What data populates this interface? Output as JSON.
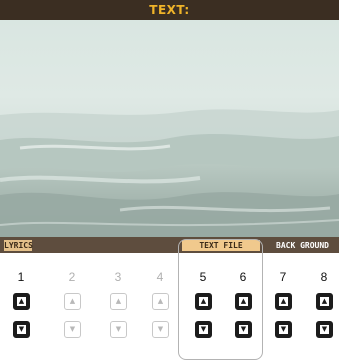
{
  "screen": {
    "title": "TEXT:"
  },
  "tabs": {
    "lyrics": "LYRICS",
    "text_file": "TEXT FILE",
    "background": "BACK GROUND"
  },
  "controls": {
    "numbers": [
      "1",
      "2",
      "3",
      "4",
      "5",
      "6",
      "7",
      "8"
    ],
    "enabled": [
      true,
      false,
      false,
      false,
      true,
      true,
      true,
      true
    ]
  },
  "colors": {
    "title_text": "#f0b429",
    "title_bar": "#3b2e22",
    "tab_strip": "#5e4d3e",
    "tab_active": "#f0c98d"
  },
  "icons": {
    "up": "up-arrow-icon",
    "down": "down-arrow-icon"
  }
}
